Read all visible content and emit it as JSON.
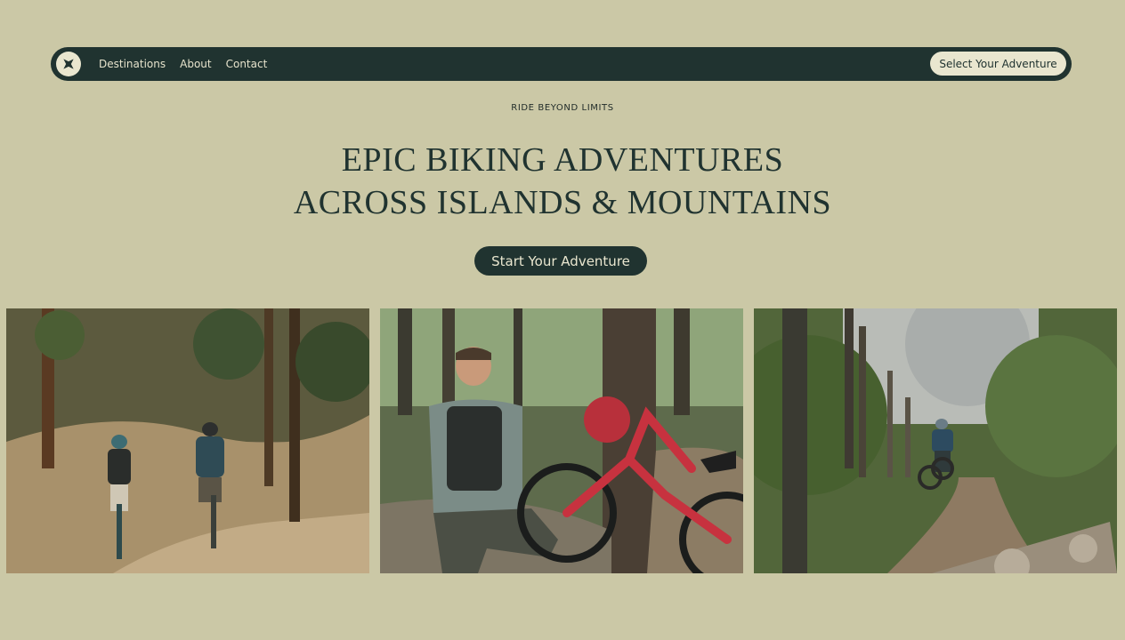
{
  "nav": {
    "logo_icon": "compass-star-icon",
    "links": [
      "Destinations",
      "About",
      "Contact"
    ],
    "cta_label": "Select Your Adventure"
  },
  "hero": {
    "eyebrow": "RIDE BEYOND LIMITS",
    "headline_line1": "EPIC BIKING ADVENTURES",
    "headline_line2": "ACROSS ISLANDS & MOUNTAINS",
    "cta_label": "Start Your Adventure"
  },
  "gallery": {
    "images": [
      {
        "description": "two-riders-forest-trail"
      },
      {
        "description": "smiling-rider-with-red-bike"
      },
      {
        "description": "rider-on-rocky-trail"
      }
    ]
  },
  "colors": {
    "background": "#cbc8a6",
    "dark": "#203330",
    "cream": "#e9e6cf"
  }
}
